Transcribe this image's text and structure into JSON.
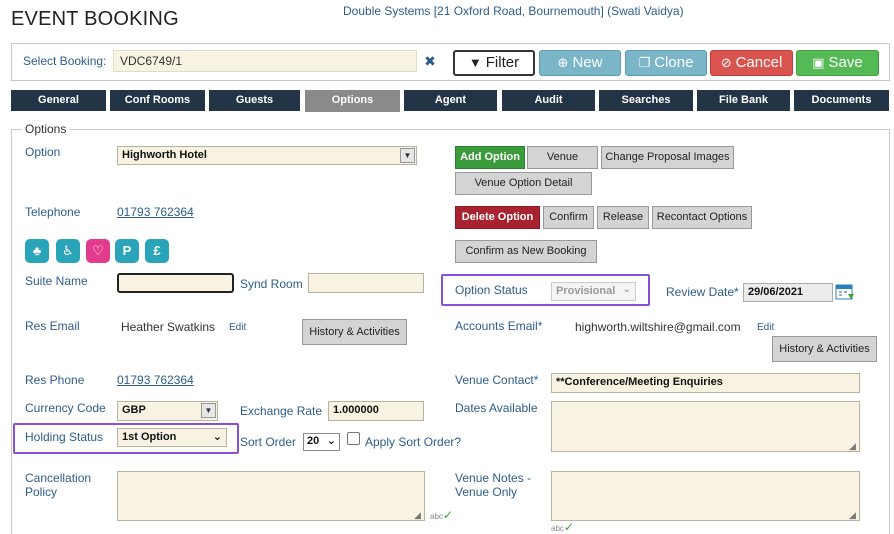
{
  "header": {
    "title": "EVENT BOOKING",
    "info": "Double Systems [21 Oxford Road, Bournemouth] (Swati Vaidya)"
  },
  "booking": {
    "label": "Select Booking:",
    "value": "VDC6749/1",
    "clear": "✖"
  },
  "toolbar": {
    "filter": "Filter",
    "new": "New",
    "clone": "Clone",
    "cancel": "Cancel",
    "save": "Save"
  },
  "tabs": [
    "General",
    "Conf Rooms",
    "Guests",
    "Options",
    "Agent",
    "Audit",
    "Searches",
    "File Bank",
    "Documents"
  ],
  "active_tab": "Options",
  "options": {
    "legend": "Options",
    "option_label": "Option",
    "option_value": "Highworth Hotel",
    "telephone_label": "Telephone",
    "telephone_value": "01793 762364",
    "suite_name_label": "Suite Name",
    "synd_room_label": "Synd Room",
    "option_status_label": "Option Status",
    "option_status_value": "Provisional",
    "review_date_label": "Review Date*",
    "review_date_value": "29/06/2021",
    "res_email_label": "Res Email",
    "res_email_value": "Heather Swatkins",
    "edit": "Edit",
    "accounts_email_label": "Accounts Email*",
    "accounts_email_value": "highworth.wiltshire@gmail.com",
    "history_button": "History & Activities",
    "res_phone_label": "Res Phone",
    "res_phone_value": "01793 762364",
    "venue_contact_label": "Venue Contact*",
    "venue_contact_value": "**Conference/Meeting Enquiries",
    "currency_code_label": "Currency Code",
    "currency_code_value": "GBP",
    "exchange_rate_label": "Exchange Rate",
    "exchange_rate_value": "1.000000",
    "dates_available_label": "Dates Available",
    "holding_status_label": "Holding Status",
    "holding_status_value": "1st Option",
    "sort_order_label": "Sort Order",
    "sort_order_value": "20",
    "apply_sort_label": "Apply Sort Order?",
    "cancellation_label_1": "Cancellation",
    "cancellation_label_2": "Policy",
    "venue_notes_label_1": "Venue Notes -",
    "venue_notes_label_2": "Venue Only",
    "spell": "abc"
  },
  "actions": {
    "add_option": "Add Option",
    "venue": "Venue",
    "change_images": "Change Proposal Images",
    "venue_option_detail": "Venue Option Detail",
    "delete_option": "Delete Option",
    "confirm": "Confirm",
    "release": "Release",
    "recontact": "Recontact Options",
    "confirm_new": "Confirm as New Booking"
  },
  "facility_icons": [
    "garden-icon",
    "wheelchair-icon",
    "wedding-rings-icon",
    "parking-icon",
    "money-icon"
  ],
  "colors": {
    "nav": "#243447",
    "active_tab": "#8a8a8a",
    "input_bg": "#f7f2e1",
    "highlight": "#8a4fd8",
    "new_clone": "#7ab6c7",
    "cancel": "#d9534f",
    "save": "#55b955"
  }
}
